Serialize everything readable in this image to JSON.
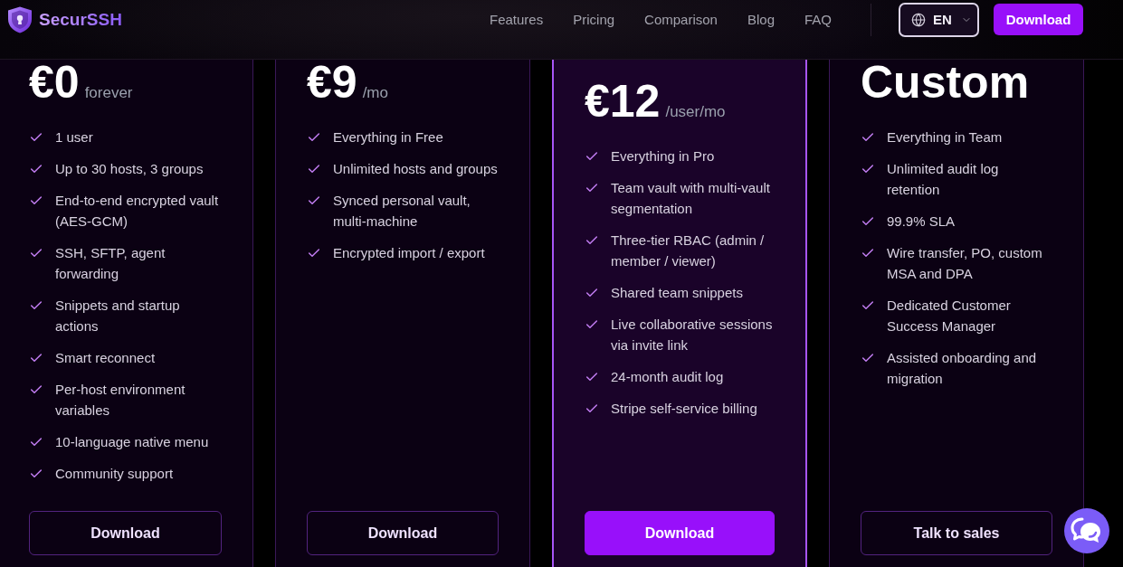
{
  "header": {
    "brand": "SecurSSH",
    "nav": [
      {
        "label": "Features"
      },
      {
        "label": "Pricing"
      },
      {
        "label": "Comparison"
      },
      {
        "label": "Blog"
      },
      {
        "label": "FAQ"
      }
    ],
    "language": "EN",
    "download": "Download"
  },
  "plans": [
    {
      "price": "€0",
      "period": "forever",
      "featured": false,
      "features": [
        "1 user",
        "Up to 30 hosts, 3 groups",
        "End-to-end encrypted vault (AES-GCM)",
        "SSH, SFTP, agent forwarding",
        "Snippets and startup actions",
        "Smart reconnect",
        "Per-host environment variables",
        "10-language native menu",
        "Community support"
      ],
      "button": "Download"
    },
    {
      "price": "€9",
      "period": "/mo",
      "featured": false,
      "features": [
        "Everything in Free",
        "Unlimited hosts and groups",
        "Synced personal vault, multi-machine",
        "Encrypted import / export"
      ],
      "button": "Download"
    },
    {
      "price": "€12",
      "period": "/user/mo",
      "featured": true,
      "features": [
        "Everything in Pro",
        "Team vault with multi-vault segmentation",
        "Three-tier RBAC (admin / member / viewer)",
        "Shared team snippets",
        "Live collaborative sessions via invite link",
        "24-month audit log",
        "Stripe self-service billing"
      ],
      "button": "Download"
    },
    {
      "price": "Custom",
      "featured": false,
      "features": [
        "Everything in Team",
        "Unlimited audit log retention",
        "99.9% SLA",
        "Wire transfer, PO, custom MSA and DPA",
        "Dedicated Customer Success Manager",
        "Assisted onboarding and migration"
      ],
      "button": "Talk to sales"
    }
  ]
}
